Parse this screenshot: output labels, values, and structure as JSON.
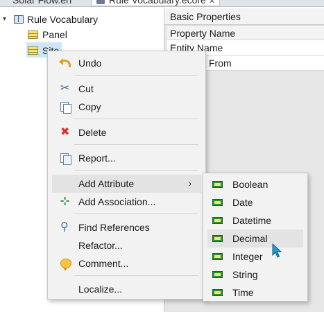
{
  "tabs": [
    {
      "label": "Solar Flow.erf"
    },
    {
      "label": "Rule Vocabulary.ecore",
      "close": "✕"
    }
  ],
  "tree": {
    "root": {
      "twisty": "▾",
      "label": "Rule Vocabulary"
    },
    "children": [
      {
        "label": "Panel"
      },
      {
        "label": "Site"
      }
    ]
  },
  "properties": {
    "header": "Basic Properties",
    "column": "Property Name",
    "rows": [
      "Entity Name",
      "From"
    ]
  },
  "context_menu": {
    "items": [
      {
        "label": "Undo",
        "icon": "undo-icon"
      },
      {
        "label": "Cut",
        "icon": "scissors-icon"
      },
      {
        "label": "Copy",
        "icon": "copy-icon"
      },
      {
        "label": "Delete",
        "icon": "delete-x-icon"
      },
      {
        "label": "Report...",
        "icon": "report-icon"
      },
      {
        "label": "Add Attribute",
        "arrow": "›",
        "highlighted": true
      },
      {
        "label": "Add Association...",
        "icon": "add-association-icon"
      },
      {
        "label": "Find References",
        "icon": "magnifier-icon"
      },
      {
        "label": "Refactor..."
      },
      {
        "label": "Comment...",
        "icon": "comment-icon"
      },
      {
        "label": "Localize..."
      }
    ]
  },
  "submenu": {
    "items": [
      {
        "label": "Boolean"
      },
      {
        "label": "Date"
      },
      {
        "label": "Datetime"
      },
      {
        "label": "Decimal",
        "highlighted": true
      },
      {
        "label": "Integer"
      },
      {
        "label": "String"
      },
      {
        "label": "Time"
      }
    ]
  },
  "colors": {
    "menu_bg": "#f2f2f2",
    "highlight": "#e3e3e3",
    "selection": "#cde6f7",
    "delete_red": "#d9342b",
    "cursor": "#1f9bd1"
  }
}
